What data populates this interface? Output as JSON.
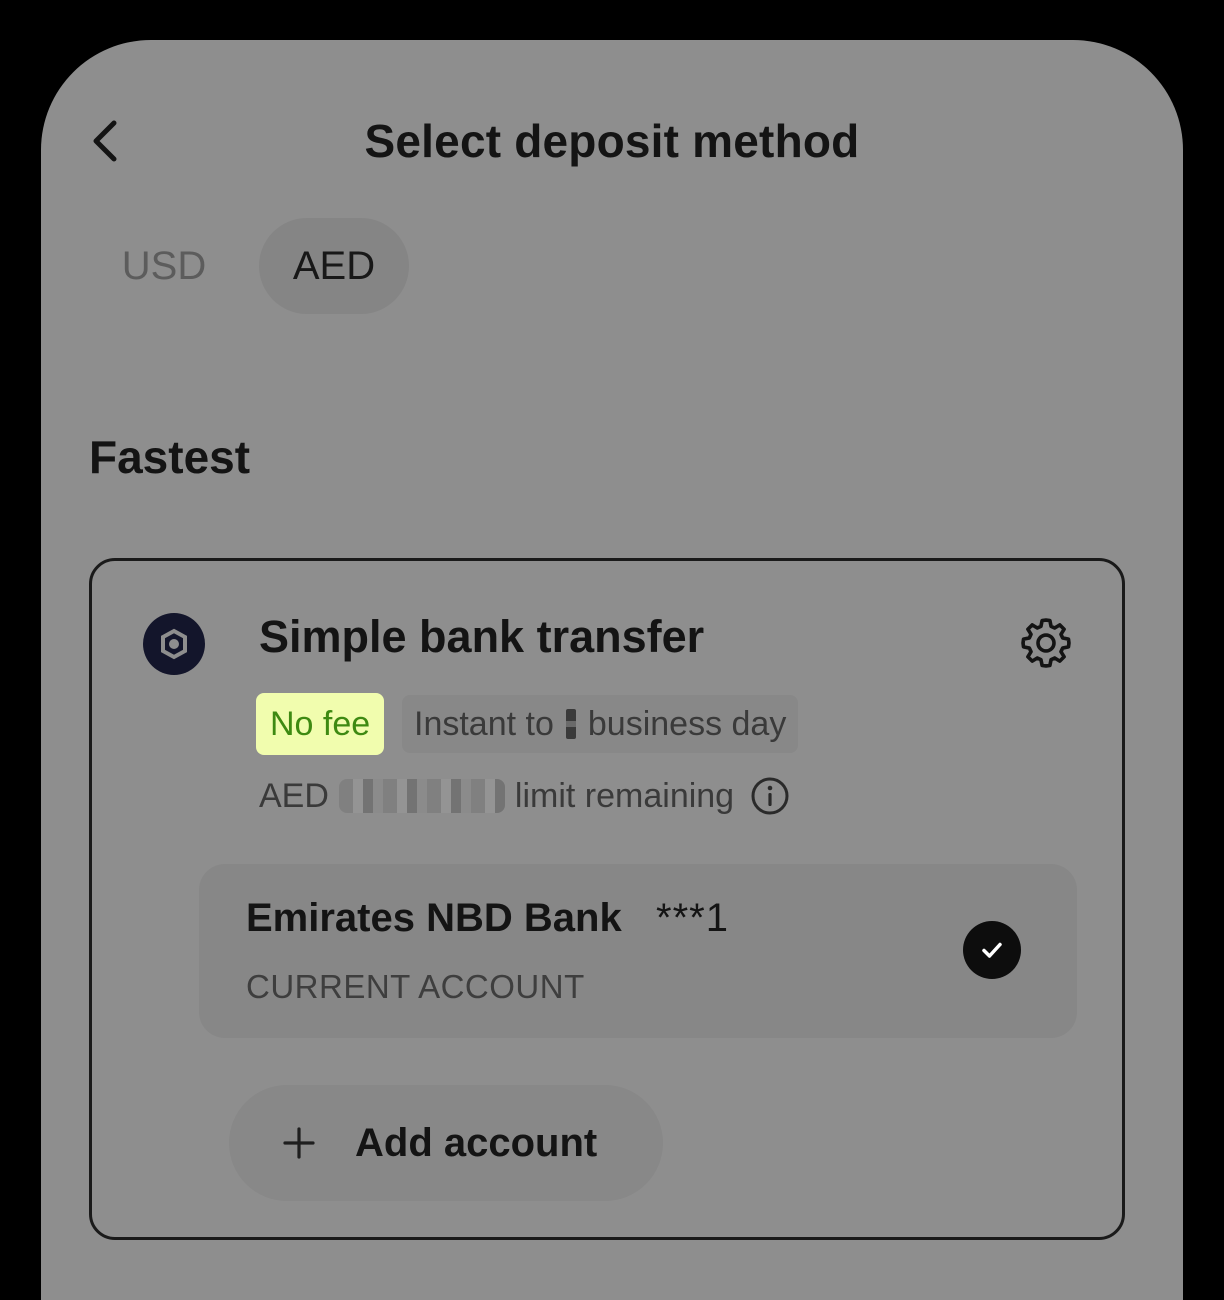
{
  "header": {
    "title": "Select deposit method",
    "back_icon": "chevron-left-icon"
  },
  "currency_tabs": {
    "items": [
      {
        "label": "USD",
        "selected": false
      },
      {
        "label": "AED",
        "selected": true
      }
    ]
  },
  "section": {
    "title": "Fastest"
  },
  "method": {
    "title": "Simple bank transfer",
    "logo_icon": "bank-logo-icon",
    "settings_icon": "gear-icon",
    "fee_badge": "No fee",
    "fee_badge_color": "#f1fdae",
    "timing_prefix": "Instant to",
    "timing_suffix": "business day",
    "limit_prefix": "AED",
    "limit_suffix": "limit remaining",
    "info_icon": "info-icon"
  },
  "account": {
    "bank_name": "Emirates NBD Bank",
    "account_mask": "***1",
    "account_type": "CURRENT ACCOUNT",
    "selected": true,
    "check_icon": "checkmark-icon"
  },
  "add_account": {
    "label": "Add account",
    "icon": "plus-icon"
  }
}
